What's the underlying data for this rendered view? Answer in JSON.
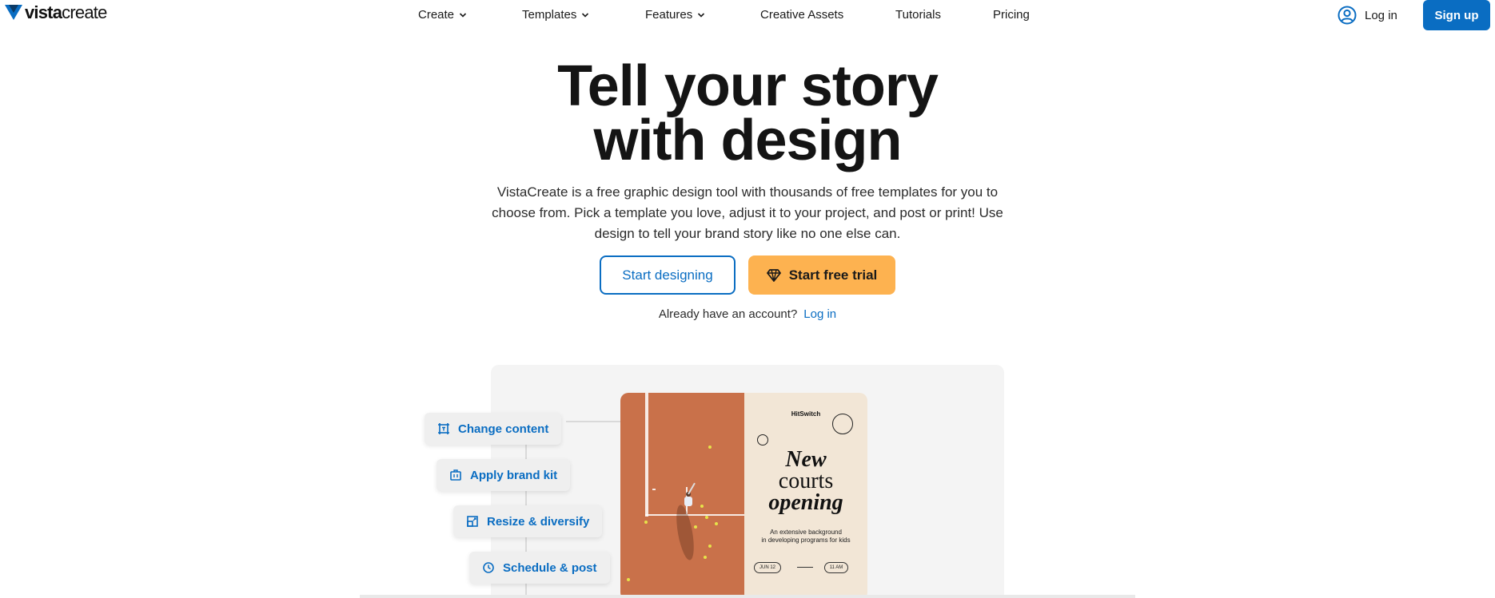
{
  "brand": {
    "logo_bold": "vista",
    "logo_regular": "create"
  },
  "nav": {
    "items": [
      {
        "label": "Create",
        "has_dropdown": true
      },
      {
        "label": "Templates",
        "has_dropdown": true
      },
      {
        "label": "Features",
        "has_dropdown": true
      },
      {
        "label": "Creative Assets",
        "has_dropdown": false
      },
      {
        "label": "Tutorials",
        "has_dropdown": false
      },
      {
        "label": "Pricing",
        "has_dropdown": false
      }
    ],
    "login_label": "Log in",
    "signup_label": "Sign up"
  },
  "hero": {
    "headline_line1": "Tell your story",
    "headline_line2": "with design",
    "subtitle": "VistaCreate is a free graphic design tool with thousands of free templates for you to choose from. Pick a template you love, adjust it to your project, and post or print! Use design to tell your brand story like no one else can.",
    "primary_button": "Start designing",
    "trial_button": "Start free trial",
    "account_prompt": "Already have an account?",
    "account_login": "Log in"
  },
  "showcase": {
    "features": [
      {
        "label": "Change content",
        "icon": "crop-icon"
      },
      {
        "label": "Apply brand kit",
        "icon": "briefcase-icon"
      },
      {
        "label": "Resize & diversify",
        "icon": "resize-icon"
      },
      {
        "label": "Schedule & post",
        "icon": "clock-icon"
      }
    ],
    "poster": {
      "brand": "HitSwitch",
      "title_line1": "New",
      "title_line2": "courts",
      "title_line3": "opening",
      "subtitle_line1": "An extensive background",
      "subtitle_line2": "in developing programs for kids",
      "date": "JUN 12",
      "time": "11 AM"
    }
  },
  "colors": {
    "accent_blue": "#0a6dc2",
    "trial_orange": "#fdb250",
    "court": "#c9714a",
    "poster_bg": "#f2e6d6"
  }
}
